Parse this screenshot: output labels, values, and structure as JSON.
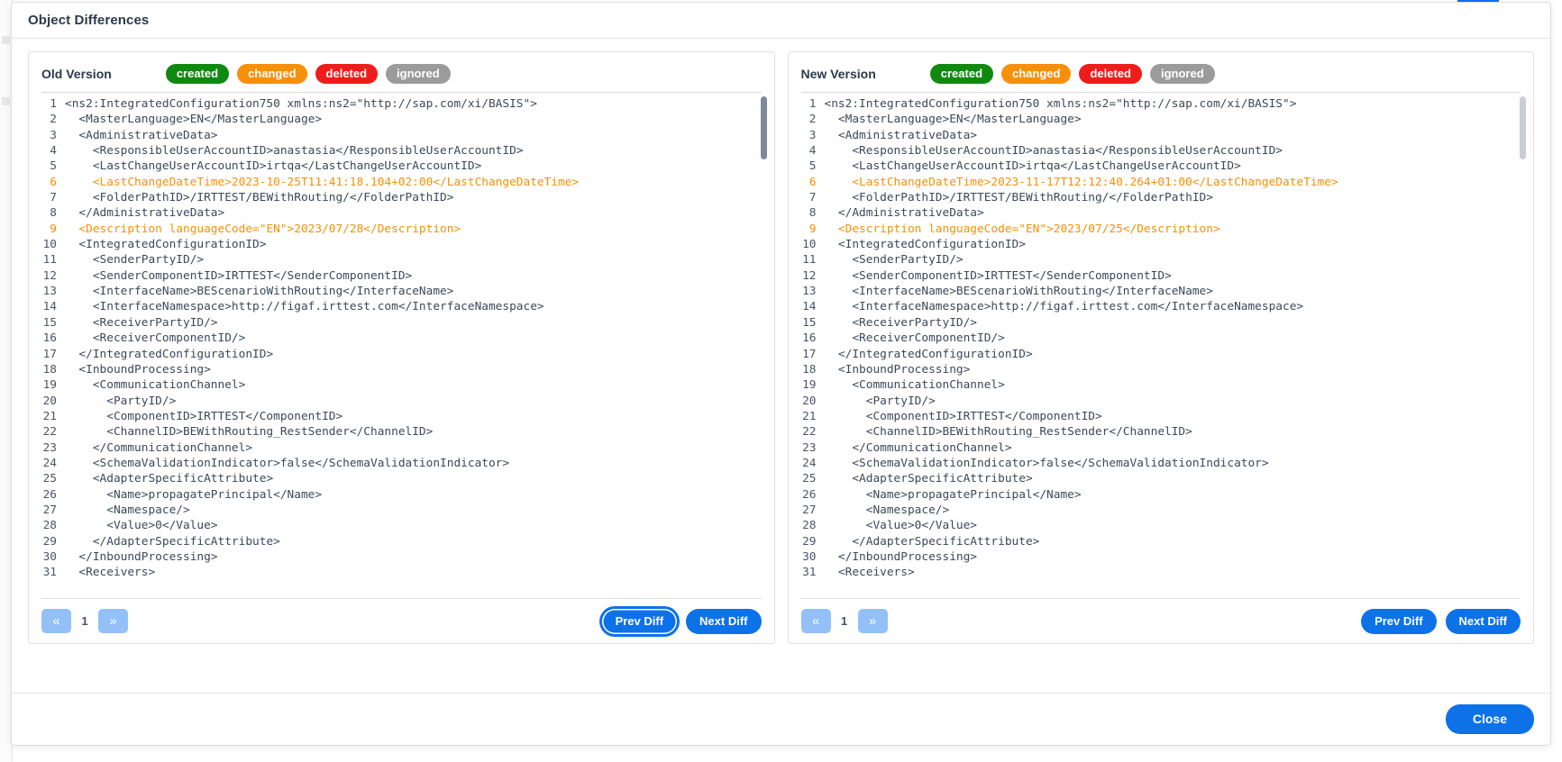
{
  "modal": {
    "title": "Object Differences",
    "close_label": "Close"
  },
  "legend": {
    "created": "created",
    "changed": "changed",
    "deleted": "deleted",
    "ignored": "ignored"
  },
  "pager": {
    "first_icon": "«",
    "last_icon": "»",
    "page": "1"
  },
  "diff_nav": {
    "prev": "Prev Diff",
    "next": "Next Diff"
  },
  "colors": {
    "created": "#108910",
    "changed": "#f79009",
    "deleted": "#f01c1c",
    "ignored": "#9b9b9b",
    "accent": "#0d72e8",
    "pager": "#93c0f7",
    "code_text": "#3c4858"
  },
  "panels": [
    {
      "label": "Old Version",
      "lines": [
        {
          "n": "1",
          "text": "<ns2:IntegratedConfiguration750 xmlns:ns2=\"http://sap.com/xi/BASIS\">",
          "diff": false
        },
        {
          "n": "2",
          "text": "  <MasterLanguage>EN</MasterLanguage>",
          "diff": false
        },
        {
          "n": "3",
          "text": "  <AdministrativeData>",
          "diff": false
        },
        {
          "n": "4",
          "text": "    <ResponsibleUserAccountID>anastasia</ResponsibleUserAccountID>",
          "diff": false
        },
        {
          "n": "5",
          "text": "    <LastChangeUserAccountID>irtqa</LastChangeUserAccountID>",
          "diff": false
        },
        {
          "n": "6",
          "text": "    <LastChangeDateTime>2023-10-25T11:41:18.104+02:00</LastChangeDateTime>",
          "diff": true
        },
        {
          "n": "7",
          "text": "    <FolderPathID>/IRTTEST/BEWithRouting/</FolderPathID>",
          "diff": false
        },
        {
          "n": "8",
          "text": "  </AdministrativeData>",
          "diff": false
        },
        {
          "n": "9",
          "text": "  <Description languageCode=\"EN\">2023/07/28</Description>",
          "diff": true,
          "tall": true
        },
        {
          "n": "10",
          "text": "  <IntegratedConfigurationID>",
          "diff": false
        },
        {
          "n": "11",
          "text": "    <SenderPartyID/>",
          "diff": false
        },
        {
          "n": "12",
          "text": "    <SenderComponentID>IRTTEST</SenderComponentID>",
          "diff": false
        },
        {
          "n": "13",
          "text": "    <InterfaceName>BEScenarioWithRouting</InterfaceName>",
          "diff": false
        },
        {
          "n": "14",
          "text": "    <InterfaceNamespace>http://figaf.irttest.com</InterfaceNamespace>",
          "diff": false
        },
        {
          "n": "15",
          "text": "    <ReceiverPartyID/>",
          "diff": false
        },
        {
          "n": "16",
          "text": "    <ReceiverComponentID/>",
          "diff": false
        },
        {
          "n": "17",
          "text": "  </IntegratedConfigurationID>",
          "diff": false
        },
        {
          "n": "18",
          "text": "  <InboundProcessing>",
          "diff": false
        },
        {
          "n": "19",
          "text": "    <CommunicationChannel>",
          "diff": false
        },
        {
          "n": "20",
          "text": "      <PartyID/>",
          "diff": false
        },
        {
          "n": "21",
          "text": "      <ComponentID>IRTTEST</ComponentID>",
          "diff": false
        },
        {
          "n": "22",
          "text": "      <ChannelID>BEWithRouting_RestSender</ChannelID>",
          "diff": false
        },
        {
          "n": "23",
          "text": "    </CommunicationChannel>",
          "diff": false
        },
        {
          "n": "24",
          "text": "    <SchemaValidationIndicator>false</SchemaValidationIndicator>",
          "diff": false
        },
        {
          "n": "25",
          "text": "    <AdapterSpecificAttribute>",
          "diff": false
        },
        {
          "n": "26",
          "text": "      <Name>propagatePrincipal</Name>",
          "diff": false
        },
        {
          "n": "27",
          "text": "      <Namespace/>",
          "diff": false
        },
        {
          "n": "28",
          "text": "      <Value>0</Value>",
          "diff": false
        },
        {
          "n": "29",
          "text": "    </AdapterSpecificAttribute>",
          "diff": false
        },
        {
          "n": "30",
          "text": "  </InboundProcessing>",
          "diff": false
        },
        {
          "n": "31",
          "text": "  <Receivers>",
          "diff": false
        }
      ]
    },
    {
      "label": "New Version",
      "lines": [
        {
          "n": "1",
          "text": "<ns2:IntegratedConfiguration750 xmlns:ns2=\"http://sap.com/xi/BASIS\">",
          "diff": false
        },
        {
          "n": "2",
          "text": "  <MasterLanguage>EN</MasterLanguage>",
          "diff": false
        },
        {
          "n": "3",
          "text": "  <AdministrativeData>",
          "diff": false
        },
        {
          "n": "4",
          "text": "    <ResponsibleUserAccountID>anastasia</ResponsibleUserAccountID>",
          "diff": false
        },
        {
          "n": "5",
          "text": "    <LastChangeUserAccountID>irtqa</LastChangeUserAccountID>",
          "diff": false
        },
        {
          "n": "6",
          "text": "    <LastChangeDateTime>2023-11-17T12:12:40.264+01:00</LastChangeDateTime>",
          "diff": true
        },
        {
          "n": "7",
          "text": "    <FolderPathID>/IRTTEST/BEWithRouting/</FolderPathID>",
          "diff": false
        },
        {
          "n": "8",
          "text": "  </AdministrativeData>",
          "diff": false
        },
        {
          "n": "9",
          "text": "  <Description languageCode=\"EN\">2023/07/25</Description>",
          "diff": true,
          "tall": true
        },
        {
          "n": "10",
          "text": "  <IntegratedConfigurationID>",
          "diff": false
        },
        {
          "n": "11",
          "text": "    <SenderPartyID/>",
          "diff": false
        },
        {
          "n": "12",
          "text": "    <SenderComponentID>IRTTEST</SenderComponentID>",
          "diff": false
        },
        {
          "n": "13",
          "text": "    <InterfaceName>BEScenarioWithRouting</InterfaceName>",
          "diff": false
        },
        {
          "n": "14",
          "text": "    <InterfaceNamespace>http://figaf.irttest.com</InterfaceNamespace>",
          "diff": false
        },
        {
          "n": "15",
          "text": "    <ReceiverPartyID/>",
          "diff": false
        },
        {
          "n": "16",
          "text": "    <ReceiverComponentID/>",
          "diff": false
        },
        {
          "n": "17",
          "text": "  </IntegratedConfigurationID>",
          "diff": false
        },
        {
          "n": "18",
          "text": "  <InboundProcessing>",
          "diff": false
        },
        {
          "n": "19",
          "text": "    <CommunicationChannel>",
          "diff": false
        },
        {
          "n": "20",
          "text": "      <PartyID/>",
          "diff": false
        },
        {
          "n": "21",
          "text": "      <ComponentID>IRTTEST</ComponentID>",
          "diff": false
        },
        {
          "n": "22",
          "text": "      <ChannelID>BEWithRouting_RestSender</ChannelID>",
          "diff": false
        },
        {
          "n": "23",
          "text": "    </CommunicationChannel>",
          "diff": false
        },
        {
          "n": "24",
          "text": "    <SchemaValidationIndicator>false</SchemaValidationIndicator>",
          "diff": false
        },
        {
          "n": "25",
          "text": "    <AdapterSpecificAttribute>",
          "diff": false
        },
        {
          "n": "26",
          "text": "      <Name>propagatePrincipal</Name>",
          "diff": false
        },
        {
          "n": "27",
          "text": "      <Namespace/>",
          "diff": false
        },
        {
          "n": "28",
          "text": "      <Value>0</Value>",
          "diff": false
        },
        {
          "n": "29",
          "text": "    </AdapterSpecificAttribute>",
          "diff": false
        },
        {
          "n": "30",
          "text": "  </InboundProcessing>",
          "diff": false
        },
        {
          "n": "31",
          "text": "  <Receivers>",
          "diff": false
        }
      ]
    }
  ]
}
